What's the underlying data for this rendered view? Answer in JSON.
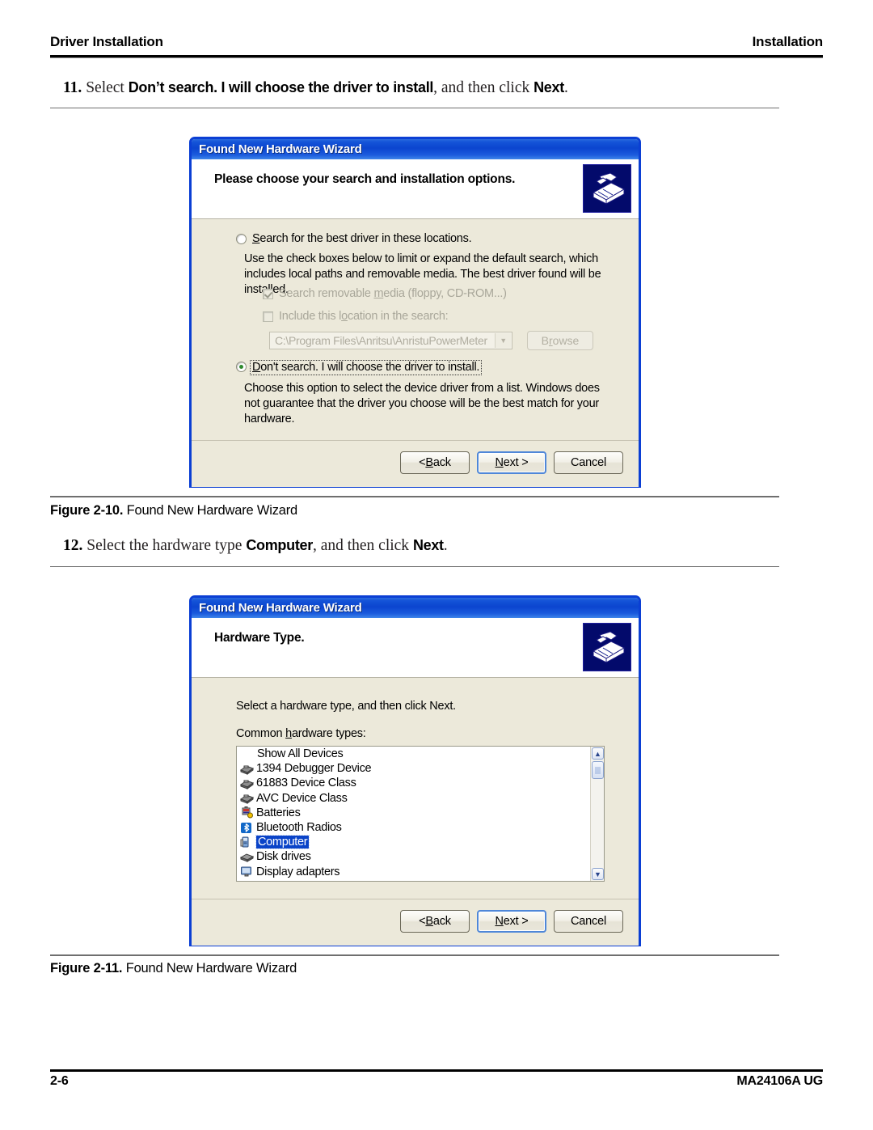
{
  "header": {
    "left": "Driver Installation",
    "right": "Installation"
  },
  "footer": {
    "page_number": "2-6",
    "doc_id": "MA24106A UG"
  },
  "steps": [
    {
      "number": "11.",
      "part1": "Select",
      "ui1": "Don’t search. I will choose the driver to install",
      "part2": ", and then click",
      "ui2": "Next",
      "part3": "."
    },
    {
      "number": "12.",
      "part1": "Select the hardware type",
      "ui1": "Computer",
      "part2": ", and then click",
      "ui2": "Next",
      "part3": "."
    }
  ],
  "captions": [
    {
      "label": "Figure 2-10.",
      "title": "Found New Hardware Wizard"
    },
    {
      "label": "Figure 2-11.",
      "title": "Found New Hardware Wizard"
    }
  ],
  "dialog1": {
    "title": "Found New Hardware Wizard",
    "header_title": "Please choose your search and installation options.",
    "option_search": {
      "label_underline": "S",
      "label_rest": "earch for the best driver in these locations.",
      "checked": false
    },
    "search_description": "Use the check boxes below to limit or expand the default search, which includes local paths and removable media. The best driver found will be installed.",
    "check_removable": {
      "pre": "Search removable ",
      "underline": "m",
      "post": "edia (floppy, CD-ROM...)",
      "checked": true,
      "disabled": true
    },
    "check_include_location": {
      "pre": "Include this l",
      "underline": "o",
      "post": "cation in the search:",
      "checked": false,
      "disabled": true
    },
    "location_path": "C:\\Program Files\\Anritsu\\AnristuPowerMeter",
    "browse_label_pre": "B",
    "browse_label_underline": "r",
    "browse_label_post": "owse",
    "option_dontsearch": {
      "label_underline": "D",
      "label_rest": "on't search. I will choose the driver to install.",
      "checked": true
    },
    "dontsearch_description": "Choose this option to select the device driver from a list.  Windows does not guarantee that the driver you choose will be the best match for your hardware.",
    "buttons": {
      "back": {
        "pre": "< ",
        "underline": "B",
        "post": "ack"
      },
      "next": {
        "pre": "",
        "underline": "N",
        "post": "ext >",
        "is_default": true
      },
      "cancel": {
        "pre": "",
        "underline": "",
        "post": "Cancel"
      }
    }
  },
  "dialog2": {
    "title": "Found New Hardware Wizard",
    "header_title": "Hardware Type.",
    "instruction": "Select a hardware type, and then click Next.",
    "list_label_pre": "Common ",
    "list_label_underline": "h",
    "list_label_post": "ardware types:",
    "list_items": [
      {
        "label": "Show All Devices",
        "icon": "none",
        "selected": false
      },
      {
        "label": "1394 Debugger Device",
        "icon": "device-icon",
        "selected": false
      },
      {
        "label": "61883 Device Class",
        "icon": "device-icon",
        "selected": false
      },
      {
        "label": "AVC Device Class",
        "icon": "device-icon",
        "selected": false
      },
      {
        "label": "Batteries",
        "icon": "battery-icon",
        "selected": false
      },
      {
        "label": "Bluetooth Radios",
        "icon": "bluetooth-icon",
        "selected": false
      },
      {
        "label": "Computer",
        "icon": "computer-icon",
        "selected": true
      },
      {
        "label": "Disk drives",
        "icon": "disk-icon",
        "selected": false
      },
      {
        "label": "Display adapters",
        "icon": "display-icon",
        "selected": false
      }
    ],
    "buttons": {
      "back": {
        "pre": "< ",
        "underline": "B",
        "post": "ack"
      },
      "next": {
        "pre": "",
        "underline": "N",
        "post": "ext >",
        "is_default": true
      },
      "cancel": {
        "pre": "",
        "underline": "",
        "post": "Cancel"
      }
    }
  },
  "colors": {
    "titlebar_blue": "#0b45cf",
    "dialog_border": "#0b3fd4",
    "dialog_body": "#ece9da",
    "selection_blue": "#0a43c8",
    "radio_dot_green": "#2f8a2f"
  }
}
